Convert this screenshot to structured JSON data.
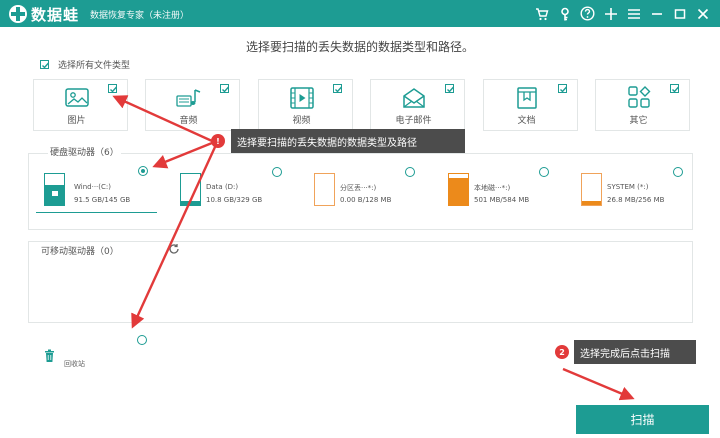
{
  "app": {
    "name": "数据蛙",
    "subtitle": "数据恢复专家（未注册）",
    "toolbar_icons": [
      "cart-icon",
      "key-icon",
      "help-icon",
      "plus-icon",
      "menu-icon",
      "minimize-icon",
      "maximize-icon",
      "close-icon"
    ]
  },
  "heading": "选择要扫描的丢失数据的数据类型和路径。",
  "select_all": {
    "label": "选择所有文件类型",
    "checked": true
  },
  "file_types": [
    {
      "label": "图片",
      "icon": "image-icon",
      "checked": true
    },
    {
      "label": "音频",
      "icon": "audio-icon",
      "checked": true
    },
    {
      "label": "视频",
      "icon": "video-icon",
      "checked": true
    },
    {
      "label": "电子邮件",
      "icon": "email-icon",
      "checked": true
    },
    {
      "label": "文档",
      "icon": "document-icon",
      "checked": true
    },
    {
      "label": "其它",
      "icon": "other-icon",
      "checked": true
    }
  ],
  "hard_drives": {
    "title": "硬盘驱动器（6）",
    "drives": [
      {
        "name": "Wind···(C:)",
        "size": "91.5 GB/145 GB",
        "used_fraction": 0.63,
        "selected": true
      },
      {
        "name": "Data (D:)",
        "size": "10.8 GB/329 GB",
        "used_fraction": 0.03,
        "selected": false
      },
      {
        "name": "分区丢···*:)",
        "size": "0.00  B/128 MB",
        "used_fraction": 0.0,
        "selected": false
      },
      {
        "name": "本地磁···*:)",
        "size": "501 MB/584 MB",
        "used_fraction": 0.86,
        "selected": false
      },
      {
        "name": "SYSTEM (*:)",
        "size": "26.8 MB/256 MB",
        "used_fraction": 0.1,
        "selected": false
      }
    ]
  },
  "removable": {
    "title": "可移动驱动器（0）"
  },
  "recycle_bin": {
    "label": "回收站",
    "selected": false
  },
  "tips": {
    "tip1": {
      "number": "!",
      "text": "选择要扫描的丢失数据的数据类型及路径"
    },
    "tip2": {
      "number": "2",
      "text": "选择完成后点击扫描"
    }
  },
  "scan_button": "扫描",
  "colors": {
    "accent": "#1d9c93",
    "drive_orange": "#f0a35a",
    "drive_dark_orange": "#ec8a1b",
    "annotation_red": "#e23a3a",
    "tip_bg": "#4c4c4c"
  }
}
